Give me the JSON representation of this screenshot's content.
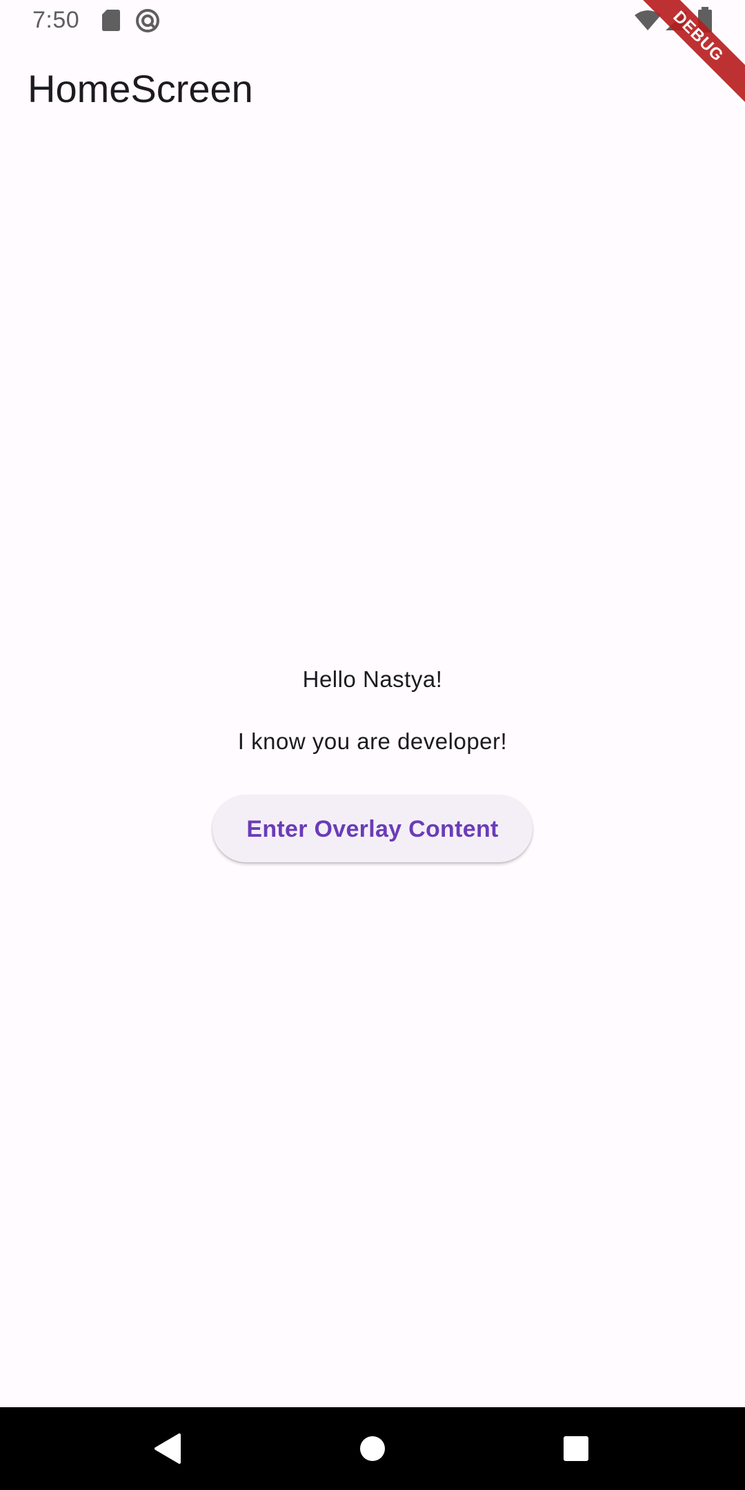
{
  "status_bar": {
    "time": "7:50",
    "icons": [
      "sd-card-icon",
      "do-not-disturb-icon",
      "wifi-icon",
      "cell-signal-icon",
      "battery-icon"
    ]
  },
  "debug_banner": {
    "label": "DEBUG",
    "color": "#b71c1c"
  },
  "app_bar": {
    "title": "HomeScreen"
  },
  "main": {
    "greeting": "Hello Nastya!",
    "message": "I know you are developer!",
    "button_label": "Enter Overlay Content",
    "button_color": "#6a3cb8"
  },
  "nav_bar": {
    "buttons": [
      "back-icon",
      "home-icon",
      "recents-icon"
    ]
  },
  "colors": {
    "background": "#fffbfe",
    "button_bg": "#f4eff7",
    "text": "#1c1b1f"
  }
}
